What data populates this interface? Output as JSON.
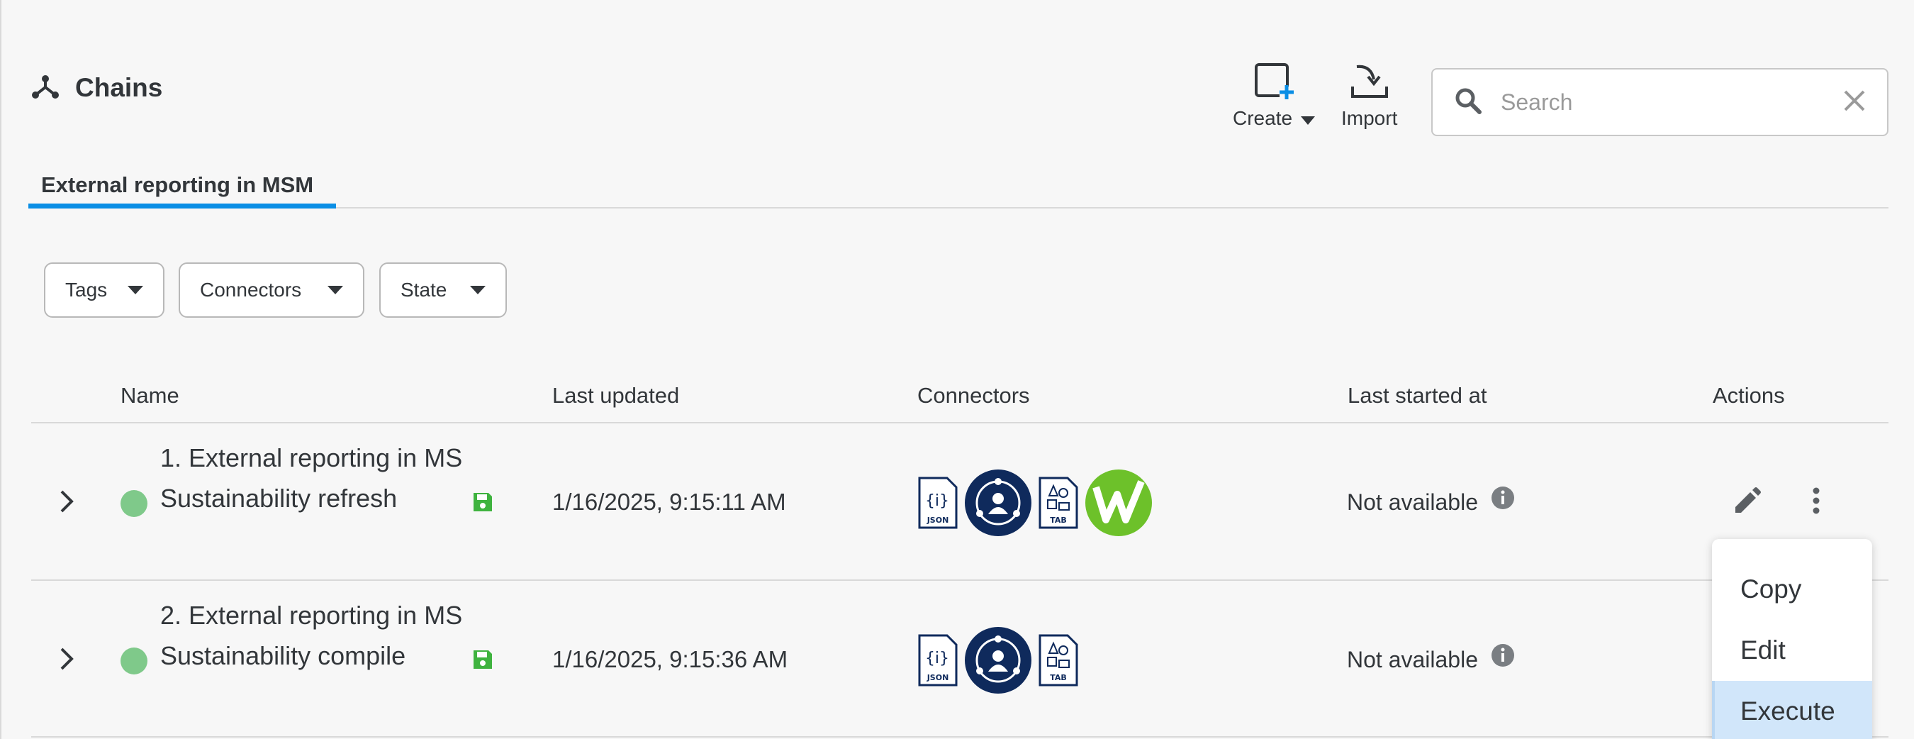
{
  "header": {
    "title": "Chains",
    "create_label": "Create",
    "import_label": "Import"
  },
  "search": {
    "placeholder": "Search"
  },
  "tabs": [
    {
      "label": "External reporting in MSM",
      "active": true
    }
  ],
  "filters": [
    {
      "label": "Tags"
    },
    {
      "label": "Connectors"
    },
    {
      "label": "State"
    }
  ],
  "table": {
    "columns": [
      "Name",
      "Last updated",
      "Connectors",
      "Last started at",
      "Actions"
    ],
    "rows": [
      {
        "name": "1. External reporting in MS Sustainability refresh",
        "last_updated": "1/16/2025, 9:15:11 AM",
        "connectors": [
          "json-file-icon",
          "people-network-icon",
          "tab-file-icon",
          "w-logo-icon"
        ],
        "last_started": "Not available",
        "state_color": "#7fc98a"
      },
      {
        "name": "2. External reporting in MS Sustainability compile",
        "last_updated": "1/16/2025, 9:15:36 AM",
        "connectors": [
          "json-file-icon",
          "people-network-icon",
          "tab-file-icon"
        ],
        "last_started": "Not available",
        "state_color": "#7fc98a"
      }
    ]
  },
  "context_menu": {
    "items": [
      {
        "label": "Copy",
        "active": false
      },
      {
        "label": "Edit",
        "active": false
      },
      {
        "label": "Execute",
        "active": true
      }
    ]
  },
  "colors": {
    "accent": "#0a8ee5",
    "state_green": "#7fc98a",
    "save_green": "#3fb33f",
    "connector_navy": "#0f2a5c",
    "w_logo_green": "#6dc12a",
    "menu_highlight": "#d1e6fa"
  }
}
